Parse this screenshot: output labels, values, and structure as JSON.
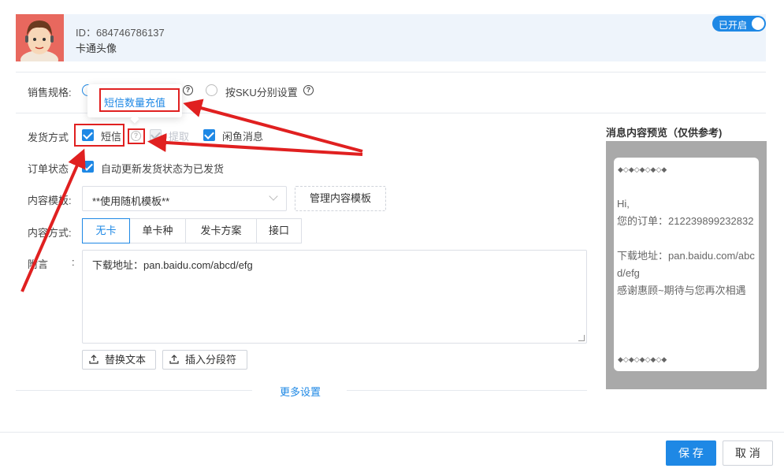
{
  "profile": {
    "id_text": "ID：684746786137",
    "name": "卡通头像",
    "toggle_label": "已开启"
  },
  "spec": {
    "label": "销售规格:",
    "option_sku": "按SKU分别设置"
  },
  "tooltip": {
    "link": "短信数量充值"
  },
  "delivery": {
    "label": "发货方式",
    "sms": "短信",
    "pickup": "提取",
    "xianyu": "闲鱼消息"
  },
  "order_status": {
    "label": "订单状态",
    "checkbox": "自动更新发货状态为已发货"
  },
  "template": {
    "label": "内容模板:",
    "value": "**使用随机模板**",
    "manage_button": "管理内容模板"
  },
  "content_mode": {
    "label": "内容方式:",
    "tabs": [
      "无卡",
      "单卡种",
      "发卡方案",
      "接口"
    ],
    "active": "无卡"
  },
  "note": {
    "label": "附言",
    "colon": ":",
    "value": "下载地址：pan.baidu.com/abcd/efg",
    "replace_button": "替换文本",
    "insert_button": "插入分段符"
  },
  "more_settings": "更多设置",
  "preview": {
    "title": "消息内容预览（仅供参考)",
    "deco": "◆◇◆◇◆◇◆◇◆",
    "lines": [
      "Hi,",
      "您的订单：212239899232832",
      "",
      "下载地址：pan.baidu.com/abcd/efg",
      "感谢惠顾~期待与您再次相遇"
    ]
  },
  "footer": {
    "save": "保 存",
    "cancel": "取 消"
  },
  "colors": {
    "primary": "#1e88e5",
    "annotation": "#e02020"
  }
}
